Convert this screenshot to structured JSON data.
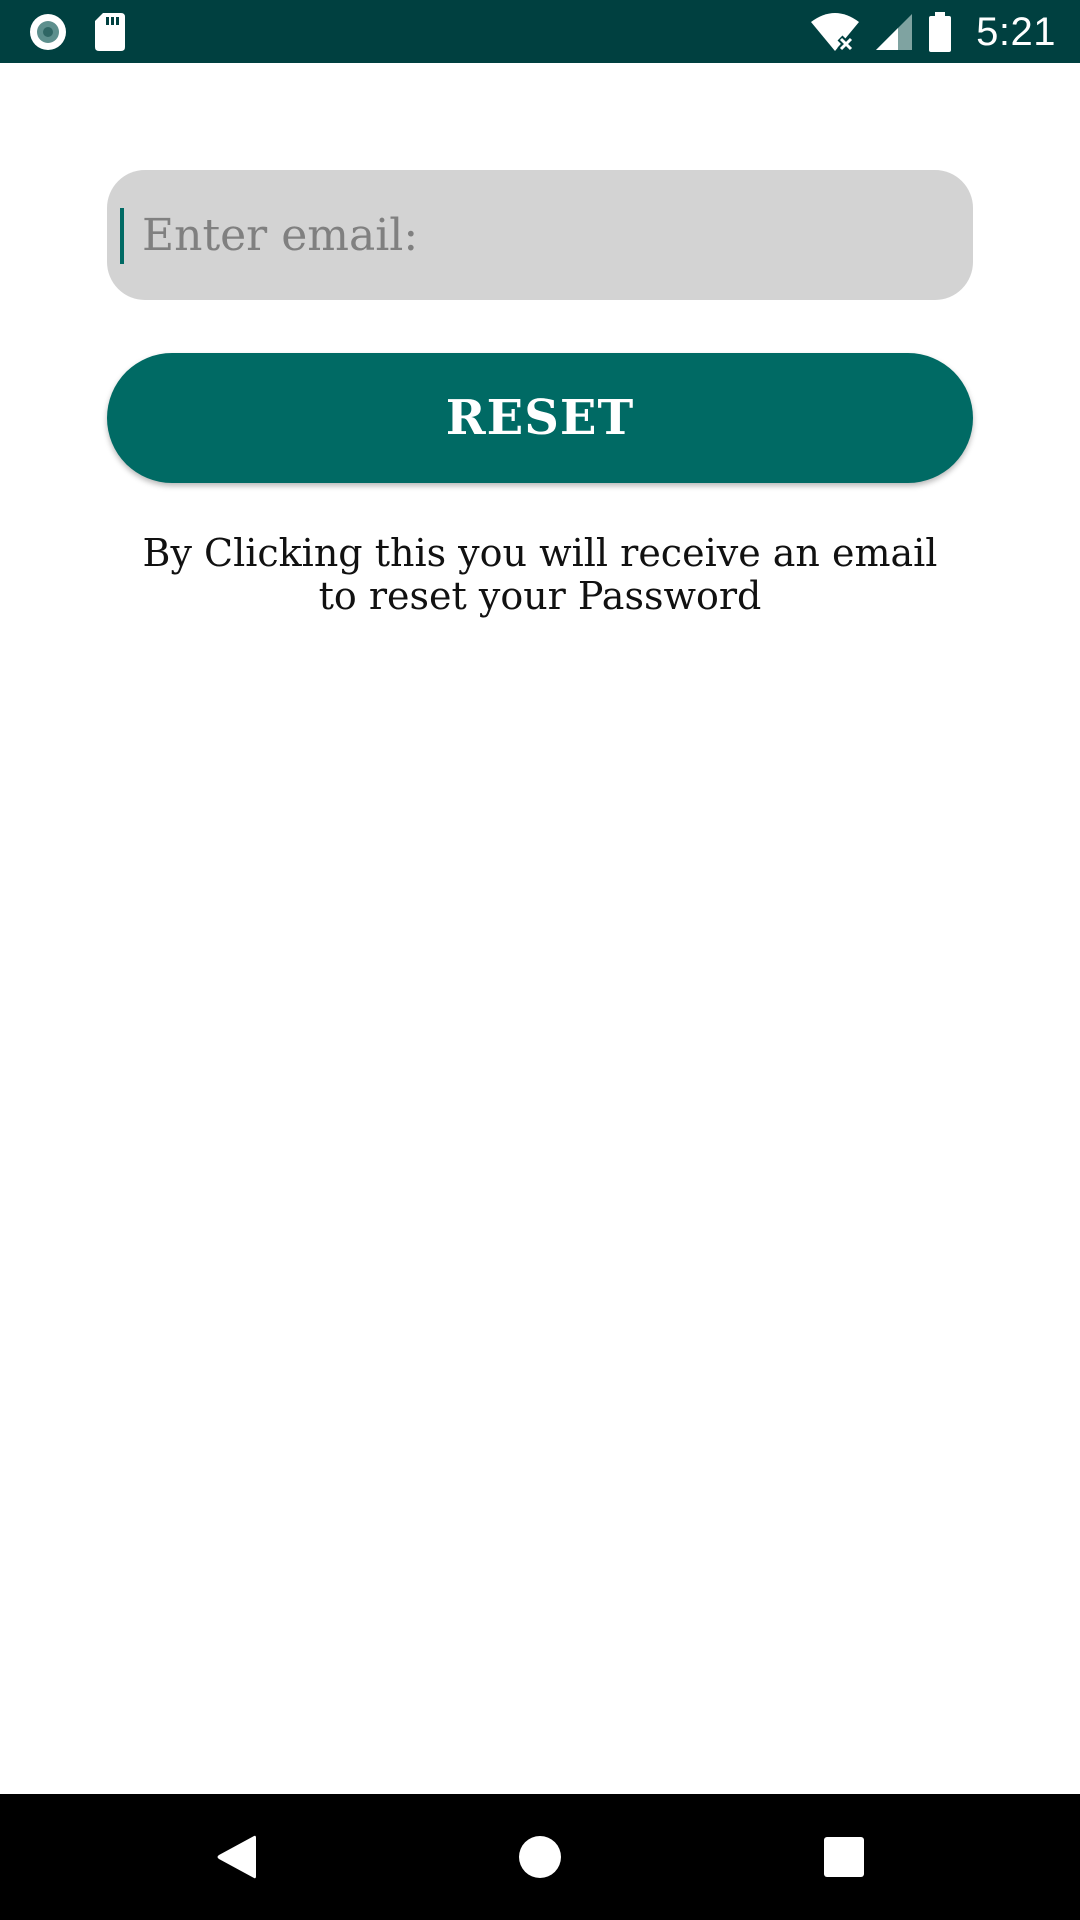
{
  "status_bar": {
    "time": "5:21",
    "icons": [
      "record-icon",
      "sd-card-icon",
      "wifi-off-icon",
      "cell-signal-icon",
      "battery-icon"
    ],
    "background_color": "#004040"
  },
  "form": {
    "email_placeholder": "Enter email:",
    "email_value": "",
    "reset_label": "RESET",
    "info_text": "By Clicking this you will receive an email to reset your Password"
  },
  "nav_bar": {
    "icons": [
      "back-icon",
      "home-icon",
      "recents-icon"
    ]
  },
  "colors": {
    "accent": "#006a64",
    "field_background": "#d3d3d3",
    "placeholder": "#808080"
  }
}
